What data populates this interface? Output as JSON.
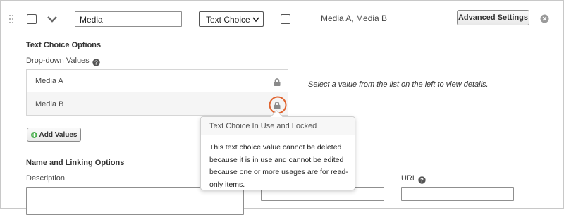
{
  "field": {
    "name_value": "Media",
    "type_value": "Text Choice",
    "summary": "Media A, Media B",
    "advanced_settings_label": "Advanced Settings"
  },
  "text_choice": {
    "section_title": "Text Choice Options",
    "dropdown_label": "Drop-down Values",
    "values": [
      "Media A",
      "Media B"
    ],
    "empty_detail_message": "Select a value from the list on the left to view details.",
    "add_values_label": "Add Values"
  },
  "tooltip": {
    "title": "Text Choice In Use and Locked",
    "body": "This text choice value cannot be deleted because it is in use and cannot be edited because one or more usages are for read-only items."
  },
  "name_linking": {
    "section_title": "Name and Linking Options",
    "description_label": "Description",
    "url_label": "URL"
  },
  "colors": {
    "highlight_ring": "#e0642f",
    "add_icon": "#4caf50"
  }
}
